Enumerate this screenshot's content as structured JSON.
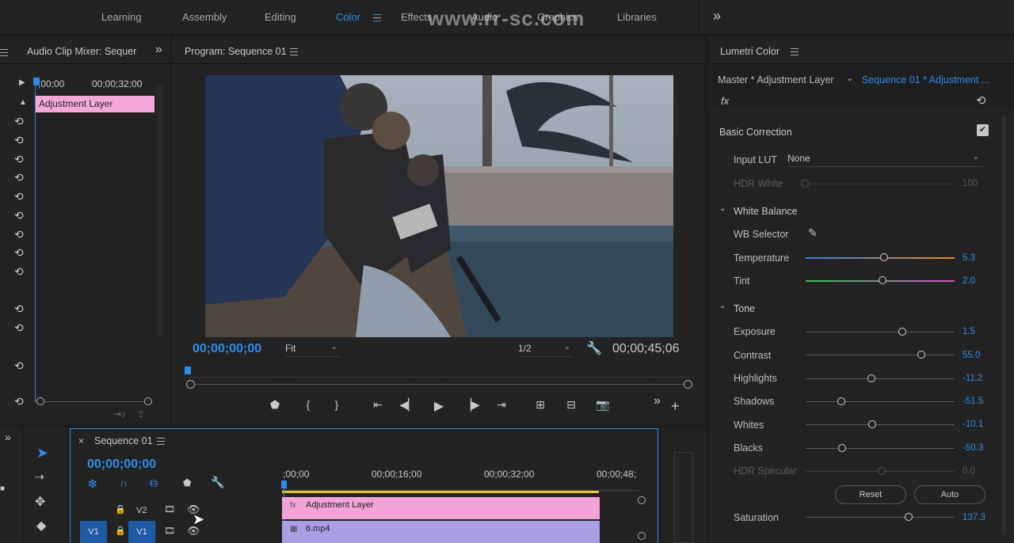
{
  "watermark": "www.rr-sc.com",
  "workspaces": [
    {
      "label": "Learning"
    },
    {
      "label": "Assembly"
    },
    {
      "label": "Editing"
    },
    {
      "label": "Color"
    },
    {
      "label": "Effects"
    },
    {
      "label": "Audio"
    },
    {
      "label": "Graphics"
    },
    {
      "label": "Libraries"
    }
  ],
  "audio_mixer": {
    "title": "Audio Clip Mixer: Sequer",
    "ruler_start": ";00;00",
    "ruler_mid": "00;00;32;00",
    "clip_label": "Adjustment Layer"
  },
  "program": {
    "title": "Program: Sequence 01",
    "timecode_current": "00;00;00;00",
    "zoom": "Fit",
    "resolution": "1/2",
    "timecode_duration": "00;00;45;06"
  },
  "lumetri": {
    "title": "Lumetri Color",
    "master_label": "Master * Adjustment Layer",
    "sequence_label": "Sequence 01 * Adjustment ...",
    "fx_label": "fx",
    "basic_correction": "Basic Correction",
    "input_lut_label": "Input LUT",
    "input_lut_value": "None",
    "hdr_white_label": "HDR White",
    "hdr_white_value": "100",
    "white_balance": "White Balance",
    "wb_selector": "WB Selector",
    "temperature_label": "Temperature",
    "temperature_value": "5.3",
    "tint_label": "Tint",
    "tint_value": "2.0",
    "tone": "Tone",
    "exposure_label": "Exposure",
    "exposure_value": "1.5",
    "contrast_label": "Contrast",
    "contrast_value": "55.0",
    "highlights_label": "Highlights",
    "highlights_value": "-11.2",
    "shadows_label": "Shadows",
    "shadows_value": "-51.5",
    "whites_label": "Whites",
    "whites_value": "-10.1",
    "blacks_label": "Blacks",
    "blacks_value": "-50.3",
    "hdr_specular_label": "HDR Specular",
    "hdr_specular_value": "0.0",
    "reset_label": "Reset",
    "auto_label": "Auto",
    "saturation_label": "Saturation",
    "saturation_value": "137.3"
  },
  "timeline": {
    "tab_title": "Sequence 01",
    "timecode": "00;00;00;00",
    "ruler": [
      ";00;00",
      "00;00;16;00",
      "00;00;32;00",
      "00;00;48;"
    ],
    "tracks": {
      "v2": "V2",
      "v1": "V1"
    },
    "clips": {
      "adjustment": "Adjustment Layer",
      "video": "6.mp4"
    }
  },
  "colors": {
    "accent": "#2d8ceb",
    "adjustment_clip": "#e99ad5",
    "video_clip": "#a99ce0"
  }
}
